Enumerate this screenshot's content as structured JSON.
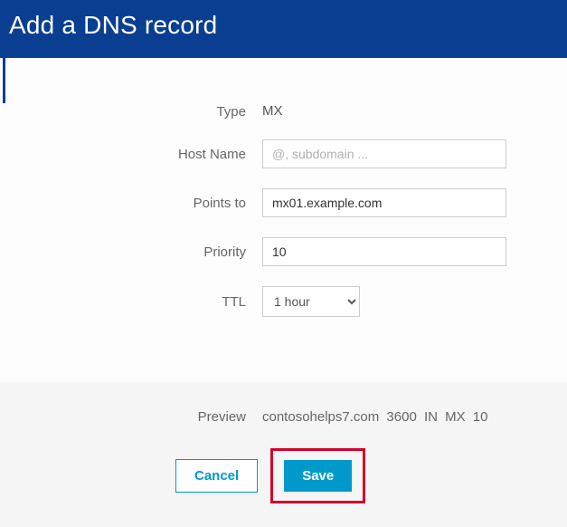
{
  "header": {
    "title": "Add a DNS record"
  },
  "form": {
    "type_label": "Type",
    "type_value": "MX",
    "hostname_label": "Host Name",
    "hostname_placeholder": "@, subdomain ...",
    "hostname_value": "",
    "pointsto_label": "Points to",
    "pointsto_value": "mx01.example.com",
    "priority_label": "Priority",
    "priority_value": "10",
    "ttl_label": "TTL",
    "ttl_value": "1 hour"
  },
  "footer": {
    "preview_label": "Preview",
    "preview_text": "contosohelps7.com 3600 IN MX 10",
    "cancel_label": "Cancel",
    "save_label": "Save"
  }
}
